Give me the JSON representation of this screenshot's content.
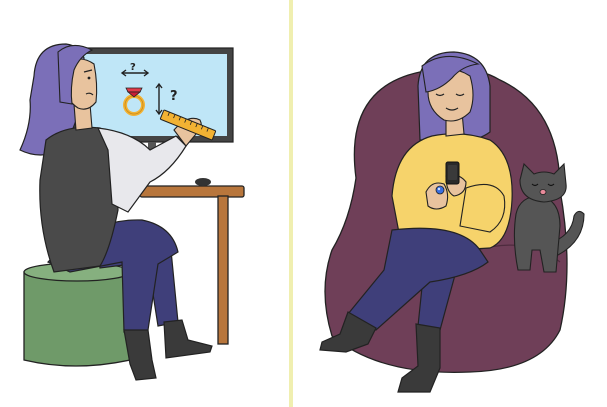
{
  "illustration": {
    "left_panel": {
      "monitor": {
        "question_top": "?",
        "question_side": "?"
      }
    }
  },
  "colors": {
    "hair": "#7b6fb8",
    "skin": "#e8c39e",
    "screen": "#bfe6f7",
    "monitor_frame": "#444444",
    "desk_wood": "#b8763c",
    "stool_green": "#6f9a69",
    "pants_navy": "#3f3f7a",
    "vest_dark": "#4a4a4a",
    "sweater_yellow": "#f6d36b",
    "beanbag_plum": "#6f3f58",
    "cat_gray": "#555555",
    "divider": "#f0efb0",
    "ring_gold": "#f2b233",
    "ring_gem": "#e23b4a"
  },
  "icons": [
    "ring-icon",
    "ruler-icon",
    "phone-icon",
    "blue-ring-icon"
  ]
}
